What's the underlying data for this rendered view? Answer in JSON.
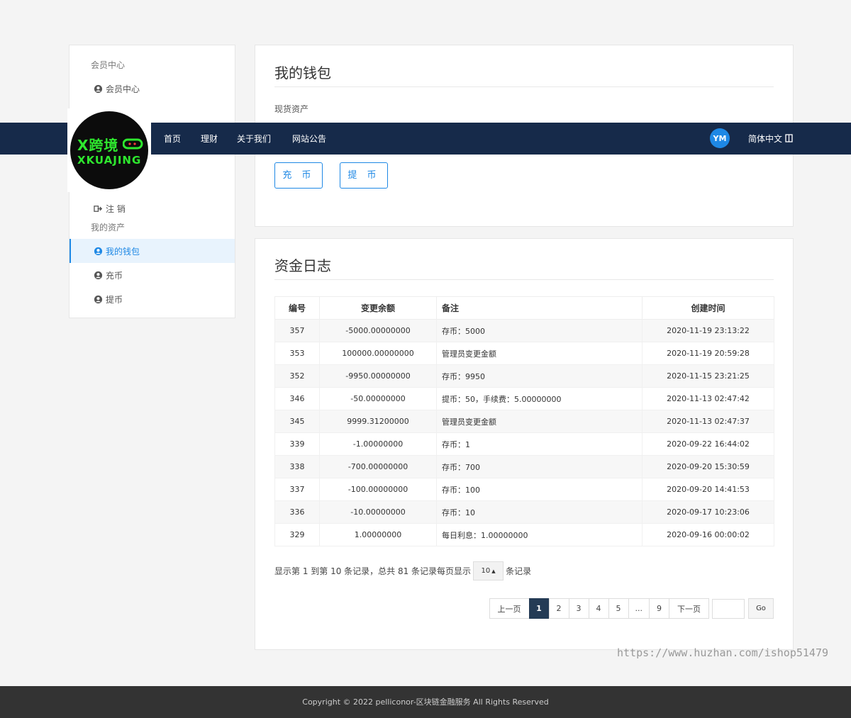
{
  "sidebar": {
    "group1_title": "会员中心",
    "item_member": "会员中心",
    "item_logout": "注 销",
    "group2_title": "我的资产",
    "item_wallet": "我的钱包",
    "item_recharge": "充币",
    "item_withdraw": "提币"
  },
  "wallet": {
    "title": "我的钱包",
    "asset_label": "现货资产",
    "recharge_btn": "充 币",
    "withdraw_btn": "提 币"
  },
  "log": {
    "title": "资金日志",
    "columns": [
      "编号",
      "变更余额",
      "备注",
      "创建时间"
    ],
    "rows": [
      [
        "357",
        "-5000.00000000",
        "存币：5000",
        "2020-11-19 23:13:22"
      ],
      [
        "353",
        "100000.00000000",
        "管理员变更金额",
        "2020-11-19 20:59:28"
      ],
      [
        "352",
        "-9950.00000000",
        "存币：9950",
        "2020-11-15 23:21:25"
      ],
      [
        "346",
        "-50.00000000",
        "提币：50，手续费：5.00000000",
        "2020-11-13 02:47:42"
      ],
      [
        "345",
        "9999.31200000",
        "管理员变更金额",
        "2020-11-13 02:47:37"
      ],
      [
        "339",
        "-1.00000000",
        "存币：1",
        "2020-09-22 16:44:02"
      ],
      [
        "338",
        "-700.00000000",
        "存币：700",
        "2020-09-20 15:30:59"
      ],
      [
        "337",
        "-100.00000000",
        "存币：100",
        "2020-09-20 14:41:53"
      ],
      [
        "336",
        "-10.00000000",
        "存币：10",
        "2020-09-17 10:23:06"
      ],
      [
        "329",
        "1.00000000",
        "每日利息：1.00000000",
        "2020-09-16 00:00:02"
      ]
    ],
    "summary_prefix": "显示第 1 到第 10 条记录，总共 81 条记录每页显示",
    "page_size": "10",
    "summary_suffix": "条记录",
    "pager": {
      "prev": "上一页",
      "pages": [
        "1",
        "2",
        "3",
        "4",
        "5",
        "...",
        "9"
      ],
      "next": "下一页",
      "go": "Go"
    }
  },
  "navbar": {
    "logo_line1": "X跨境",
    "logo_line2": "XKUAJING",
    "links": [
      "首页",
      "理财",
      "关于我们",
      "网站公告"
    ],
    "lang_icon": "YM",
    "language": "简体中文"
  },
  "watermark": "https://www.huzhan.com/ishop51479",
  "footer": "Copyright © 2022 pelliconor-区块链金融服务 All Rights Reserved"
}
